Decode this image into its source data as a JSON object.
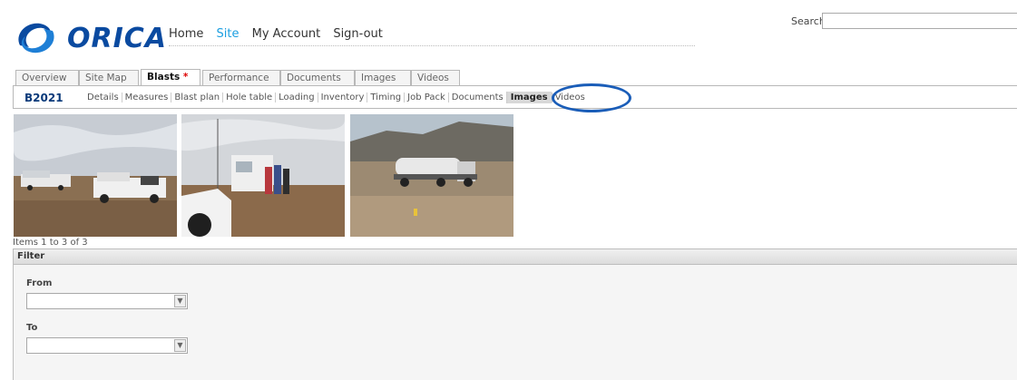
{
  "brand": {
    "name": "ORICA",
    "color": "#0a4aa0"
  },
  "top_nav": {
    "home": "Home",
    "site": "Site",
    "account": "My Account",
    "signout": "Sign-out"
  },
  "search": {
    "label": "Search",
    "value": ""
  },
  "tabs": [
    "Overview",
    "Site Map",
    "Blasts",
    "Performance",
    "Documents",
    "Images",
    "Videos"
  ],
  "active_tab_marker": "*",
  "blast": {
    "id": "B2021",
    "subnav": [
      "Details",
      "Measures",
      "Blast plan",
      "Hole table",
      "Loading",
      "Inventory",
      "Timing",
      "Job Pack",
      "Documents",
      "Images",
      "Videos"
    ],
    "active_subnav": "Images"
  },
  "gallery": {
    "items_text": "Items 1 to 3 of 3"
  },
  "filter": {
    "title": "Filter",
    "from_label": "From",
    "from_value": "",
    "to_label": "To",
    "to_value": ""
  },
  "colors": {
    "highlight_circle": "#1a5db8",
    "active_nav": "#1a9ee0",
    "tab_star": "#dd0000"
  }
}
